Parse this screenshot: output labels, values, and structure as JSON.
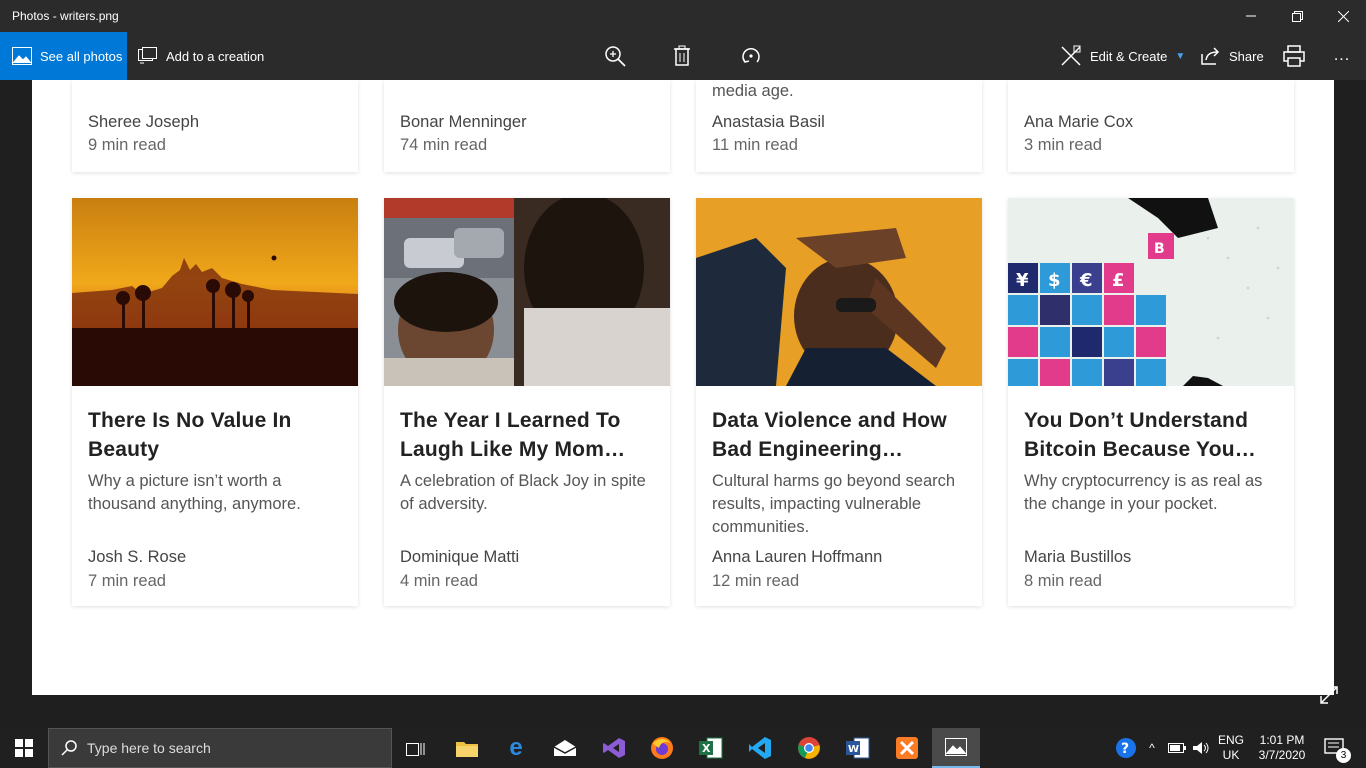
{
  "window": {
    "title": "Photos - writers.png"
  },
  "toolbar": {
    "see_all": "See all photos",
    "add_creation": "Add to a creation",
    "edit_create": "Edit & Create",
    "share": "Share",
    "more": "..."
  },
  "top_row": [
    {
      "excerpt": "",
      "author": "Sheree Joseph",
      "read": "9 min read"
    },
    {
      "excerpt": "",
      "author": "Bonar Menninger",
      "read": "74 min read"
    },
    {
      "excerpt": "media age.",
      "author": "Anastasia Basil",
      "read": "11 min read"
    },
    {
      "excerpt": "",
      "author": "Ana Marie Cox",
      "read": "3 min read"
    }
  ],
  "cards": [
    {
      "title": "There Is No Value In Beauty",
      "subtitle": "Why a picture isn’t worth a thousand anything, anymore.",
      "author": "Josh S. Rose",
      "read": "7 min read"
    },
    {
      "title": "The Year I Learned To Laugh Like My Mom…",
      "subtitle": "A celebration of Black Joy in spite of adversity.",
      "author": "Dominique Matti",
      "read": "4 min read"
    },
    {
      "title": "Data Violence and How Bad Engineering…",
      "subtitle": "Cultural harms go beyond search results, impacting vulnerable communities.",
      "author": "Anna Lauren Hoffmann",
      "read": "12 min read"
    },
    {
      "title": "You Don’t Understand Bitcoin Because You…",
      "subtitle": "Why cryptocurrency is as real as the change in your pocket.",
      "author": "Maria Bustillos",
      "read": "8 min read"
    }
  ],
  "taskbar": {
    "search_placeholder": "Type here to search",
    "lang1": "ENG",
    "lang2": "UK",
    "time": "1:01 PM",
    "date": "3/7/2020",
    "notif_count": "3"
  },
  "colors": {
    "accent": "#0078d7",
    "titlebar": "#2b2b2b",
    "taskbar": "#202020"
  }
}
